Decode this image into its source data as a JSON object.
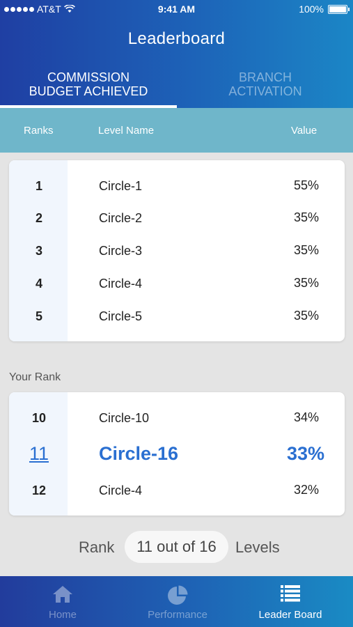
{
  "status_bar": {
    "carrier": "AT&T",
    "time": "9:41 AM",
    "battery": "100%"
  },
  "header": {
    "title": "Leaderboard"
  },
  "tabs": [
    {
      "line1": "Commission",
      "line2": "Budget Achieved",
      "active": true
    },
    {
      "line1": "Branch",
      "line2": "Activation",
      "active": false
    }
  ],
  "columns": {
    "rank": "Ranks",
    "name": "Level Name",
    "value": "Value"
  },
  "top_ranks": [
    {
      "rank": "1",
      "name": "Circle-1",
      "value": "55%"
    },
    {
      "rank": "2",
      "name": "Circle-2",
      "value": "35%"
    },
    {
      "rank": "3",
      "name": "Circle-3",
      "value": "35%"
    },
    {
      "rank": "4",
      "name": "Circle-4",
      "value": "35%"
    },
    {
      "rank": "5",
      "name": "Circle-5",
      "value": "35%"
    }
  ],
  "your_rank": {
    "label": "Your Rank",
    "rows": [
      {
        "rank": "10",
        "name": "Circle-10",
        "value": "34%"
      },
      {
        "rank": "11",
        "name": "Circle-16",
        "value": "33%"
      },
      {
        "rank": "12",
        "name": "Circle-4",
        "value": "32%"
      }
    ]
  },
  "rank_summary": {
    "prefix": "Rank",
    "value": "11 out of 16",
    "suffix": "Levels"
  },
  "bottom_nav": [
    {
      "label": "Home",
      "icon": "home-icon",
      "active": false
    },
    {
      "label": "Performance",
      "icon": "pie-chart-icon",
      "active": false
    },
    {
      "label": "Leader Board",
      "icon": "list-icon",
      "active": true
    }
  ],
  "colors": {
    "accent": "#2a6fd1",
    "column_header": "#6fb6ca",
    "header_start": "#1f3fa3",
    "header_end": "#1b86c6"
  }
}
